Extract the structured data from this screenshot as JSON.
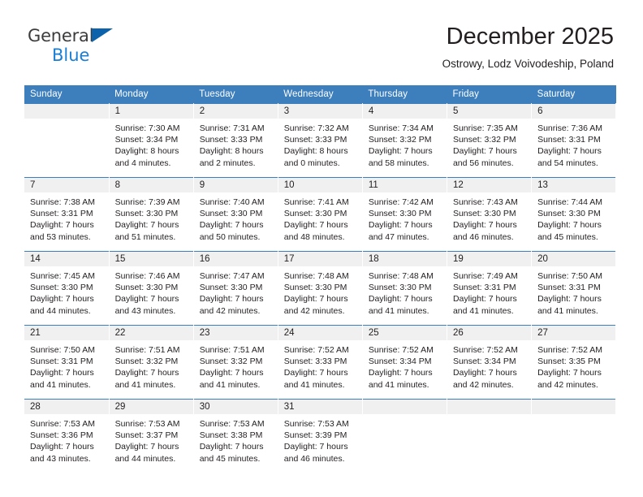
{
  "brand": {
    "name_part1": "General",
    "name_part2": "Blue",
    "triangle_icon": "triangle-icon",
    "colors": {
      "dark": "#3c3c3c",
      "blue": "#1a7fd4",
      "triangle": "#0c63ac"
    }
  },
  "header": {
    "title": "December 2025",
    "subtitle": "Ostrowy, Lodz Voivodeship, Poland"
  },
  "calendar": {
    "accent_color": "#3d7ebd",
    "daynum_band_color": "#f0f0f0",
    "weekday_headers": [
      "Sunday",
      "Monday",
      "Tuesday",
      "Wednesday",
      "Thursday",
      "Friday",
      "Saturday"
    ],
    "weeks": [
      [
        {
          "day": "",
          "lines": []
        },
        {
          "day": "1",
          "lines": [
            "Sunrise: 7:30 AM",
            "Sunset: 3:34 PM",
            "Daylight: 8 hours",
            "and 4 minutes."
          ]
        },
        {
          "day": "2",
          "lines": [
            "Sunrise: 7:31 AM",
            "Sunset: 3:33 PM",
            "Daylight: 8 hours",
            "and 2 minutes."
          ]
        },
        {
          "day": "3",
          "lines": [
            "Sunrise: 7:32 AM",
            "Sunset: 3:33 PM",
            "Daylight: 8 hours",
            "and 0 minutes."
          ]
        },
        {
          "day": "4",
          "lines": [
            "Sunrise: 7:34 AM",
            "Sunset: 3:32 PM",
            "Daylight: 7 hours",
            "and 58 minutes."
          ]
        },
        {
          "day": "5",
          "lines": [
            "Sunrise: 7:35 AM",
            "Sunset: 3:32 PM",
            "Daylight: 7 hours",
            "and 56 minutes."
          ]
        },
        {
          "day": "6",
          "lines": [
            "Sunrise: 7:36 AM",
            "Sunset: 3:31 PM",
            "Daylight: 7 hours",
            "and 54 minutes."
          ]
        }
      ],
      [
        {
          "day": "7",
          "lines": [
            "Sunrise: 7:38 AM",
            "Sunset: 3:31 PM",
            "Daylight: 7 hours",
            "and 53 minutes."
          ]
        },
        {
          "day": "8",
          "lines": [
            "Sunrise: 7:39 AM",
            "Sunset: 3:30 PM",
            "Daylight: 7 hours",
            "and 51 minutes."
          ]
        },
        {
          "day": "9",
          "lines": [
            "Sunrise: 7:40 AM",
            "Sunset: 3:30 PM",
            "Daylight: 7 hours",
            "and 50 minutes."
          ]
        },
        {
          "day": "10",
          "lines": [
            "Sunrise: 7:41 AM",
            "Sunset: 3:30 PM",
            "Daylight: 7 hours",
            "and 48 minutes."
          ]
        },
        {
          "day": "11",
          "lines": [
            "Sunrise: 7:42 AM",
            "Sunset: 3:30 PM",
            "Daylight: 7 hours",
            "and 47 minutes."
          ]
        },
        {
          "day": "12",
          "lines": [
            "Sunrise: 7:43 AM",
            "Sunset: 3:30 PM",
            "Daylight: 7 hours",
            "and 46 minutes."
          ]
        },
        {
          "day": "13",
          "lines": [
            "Sunrise: 7:44 AM",
            "Sunset: 3:30 PM",
            "Daylight: 7 hours",
            "and 45 minutes."
          ]
        }
      ],
      [
        {
          "day": "14",
          "lines": [
            "Sunrise: 7:45 AM",
            "Sunset: 3:30 PM",
            "Daylight: 7 hours",
            "and 44 minutes."
          ]
        },
        {
          "day": "15",
          "lines": [
            "Sunrise: 7:46 AM",
            "Sunset: 3:30 PM",
            "Daylight: 7 hours",
            "and 43 minutes."
          ]
        },
        {
          "day": "16",
          "lines": [
            "Sunrise: 7:47 AM",
            "Sunset: 3:30 PM",
            "Daylight: 7 hours",
            "and 42 minutes."
          ]
        },
        {
          "day": "17",
          "lines": [
            "Sunrise: 7:48 AM",
            "Sunset: 3:30 PM",
            "Daylight: 7 hours",
            "and 42 minutes."
          ]
        },
        {
          "day": "18",
          "lines": [
            "Sunrise: 7:48 AM",
            "Sunset: 3:30 PM",
            "Daylight: 7 hours",
            "and 41 minutes."
          ]
        },
        {
          "day": "19",
          "lines": [
            "Sunrise: 7:49 AM",
            "Sunset: 3:31 PM",
            "Daylight: 7 hours",
            "and 41 minutes."
          ]
        },
        {
          "day": "20",
          "lines": [
            "Sunrise: 7:50 AM",
            "Sunset: 3:31 PM",
            "Daylight: 7 hours",
            "and 41 minutes."
          ]
        }
      ],
      [
        {
          "day": "21",
          "lines": [
            "Sunrise: 7:50 AM",
            "Sunset: 3:31 PM",
            "Daylight: 7 hours",
            "and 41 minutes."
          ]
        },
        {
          "day": "22",
          "lines": [
            "Sunrise: 7:51 AM",
            "Sunset: 3:32 PM",
            "Daylight: 7 hours",
            "and 41 minutes."
          ]
        },
        {
          "day": "23",
          "lines": [
            "Sunrise: 7:51 AM",
            "Sunset: 3:32 PM",
            "Daylight: 7 hours",
            "and 41 minutes."
          ]
        },
        {
          "day": "24",
          "lines": [
            "Sunrise: 7:52 AM",
            "Sunset: 3:33 PM",
            "Daylight: 7 hours",
            "and 41 minutes."
          ]
        },
        {
          "day": "25",
          "lines": [
            "Sunrise: 7:52 AM",
            "Sunset: 3:34 PM",
            "Daylight: 7 hours",
            "and 41 minutes."
          ]
        },
        {
          "day": "26",
          "lines": [
            "Sunrise: 7:52 AM",
            "Sunset: 3:34 PM",
            "Daylight: 7 hours",
            "and 42 minutes."
          ]
        },
        {
          "day": "27",
          "lines": [
            "Sunrise: 7:52 AM",
            "Sunset: 3:35 PM",
            "Daylight: 7 hours",
            "and 42 minutes."
          ]
        }
      ],
      [
        {
          "day": "28",
          "lines": [
            "Sunrise: 7:53 AM",
            "Sunset: 3:36 PM",
            "Daylight: 7 hours",
            "and 43 minutes."
          ]
        },
        {
          "day": "29",
          "lines": [
            "Sunrise: 7:53 AM",
            "Sunset: 3:37 PM",
            "Daylight: 7 hours",
            "and 44 minutes."
          ]
        },
        {
          "day": "30",
          "lines": [
            "Sunrise: 7:53 AM",
            "Sunset: 3:38 PM",
            "Daylight: 7 hours",
            "and 45 minutes."
          ]
        },
        {
          "day": "31",
          "lines": [
            "Sunrise: 7:53 AM",
            "Sunset: 3:39 PM",
            "Daylight: 7 hours",
            "and 46 minutes."
          ]
        },
        {
          "day": "",
          "lines": []
        },
        {
          "day": "",
          "lines": []
        },
        {
          "day": "",
          "lines": []
        }
      ]
    ]
  }
}
